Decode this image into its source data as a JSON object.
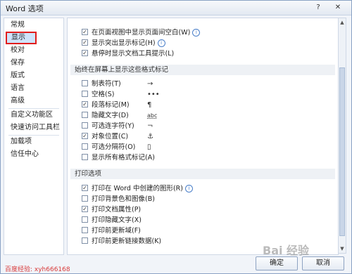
{
  "window": {
    "title": "Word 选项",
    "help": "?",
    "close": "✕"
  },
  "sidebar": {
    "items": [
      {
        "label": "常规"
      },
      {
        "label": "显示"
      },
      {
        "label": "校对"
      },
      {
        "label": "保存"
      },
      {
        "label": "版式"
      },
      {
        "label": "语言"
      },
      {
        "label": "高级"
      },
      {
        "label": "自定义功能区"
      },
      {
        "label": "快速访问工具栏"
      },
      {
        "label": "加载项"
      },
      {
        "label": "信任中心"
      }
    ]
  },
  "top_options": [
    {
      "label": "在页面视图中显示页面间空白(W)",
      "checked": true,
      "info": "i"
    },
    {
      "label": "显示突出显示标记(H)",
      "checked": true,
      "info": "i"
    },
    {
      "label": "悬停时显示文档工具提示(L)",
      "checked": true
    }
  ],
  "format_section": {
    "header": "始终在屏幕上显示这些格式标记",
    "items": [
      {
        "label": "制表符(T)",
        "checked": false,
        "mark": "→"
      },
      {
        "label": "空格(S)",
        "checked": false,
        "mark": "•••"
      },
      {
        "label": "段落标记(M)",
        "checked": true,
        "mark": "¶"
      },
      {
        "label": "隐藏文字(D)",
        "checked": false,
        "mark": "abc"
      },
      {
        "label": "可选连字符(Y)",
        "checked": false,
        "mark": "¬"
      },
      {
        "label": "对象位置(C)",
        "checked": true,
        "mark": "⚓"
      },
      {
        "label": "可选分隔符(O)",
        "checked": false,
        "mark": "▯"
      },
      {
        "label": "显示所有格式标记(A)",
        "checked": false,
        "mark": ""
      }
    ]
  },
  "print_section": {
    "header": "打印选项",
    "items": [
      {
        "label": "打印在 Word 中创建的图形(R)",
        "checked": true,
        "info": "i"
      },
      {
        "label": "打印背景色和图像(B)",
        "checked": false
      },
      {
        "label": "打印文档属性(P)",
        "checked": true
      },
      {
        "label": "打印隐藏文字(X)",
        "checked": false
      },
      {
        "label": "打印前更新域(F)",
        "checked": false
      },
      {
        "label": "打印前更新链接数据(K)",
        "checked": false
      }
    ]
  },
  "buttons": {
    "ok": "确定",
    "cancel": "取消"
  },
  "watermark": {
    "left": "百度经验: xyh666168",
    "right": "Bai 经验"
  },
  "check_glyph": "✓",
  "colors": {
    "selection_outline": "#e11c1c",
    "selected_bg": "#cfe3fb",
    "accent": "#4a7fc9"
  }
}
